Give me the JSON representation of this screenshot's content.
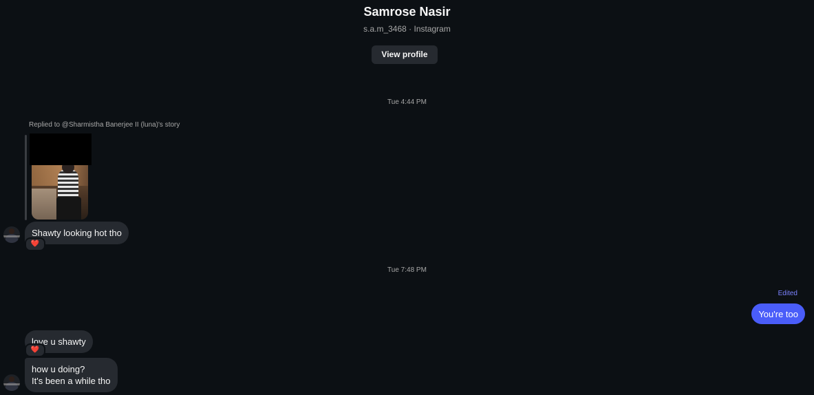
{
  "header": {
    "name": "Samrose Nasir",
    "subtitle": "s.a.m_3468 · Instagram",
    "view_profile_label": "View profile"
  },
  "thread": {
    "timestamp_1": "Tue 4:44 PM",
    "story_reply_label": "Replied to @Sharmistha Banerjee II (luna)'s story",
    "message_1": "Shawty looking hot tho",
    "reaction_1": "❤️",
    "timestamp_2": "Tue 7:48 PM",
    "sent_edited_label": "Edited",
    "sent_message": "You're too",
    "message_3": "love u shawty",
    "reaction_2": "❤️",
    "message_4": "how u doing?\nIt's been a while tho"
  },
  "colors": {
    "background": "#0c1014",
    "received_bubble": "#262a30",
    "sent_bubble": "#4a5df9",
    "edited_label": "#7c82ff",
    "reaction_heart": "#ff3040"
  }
}
